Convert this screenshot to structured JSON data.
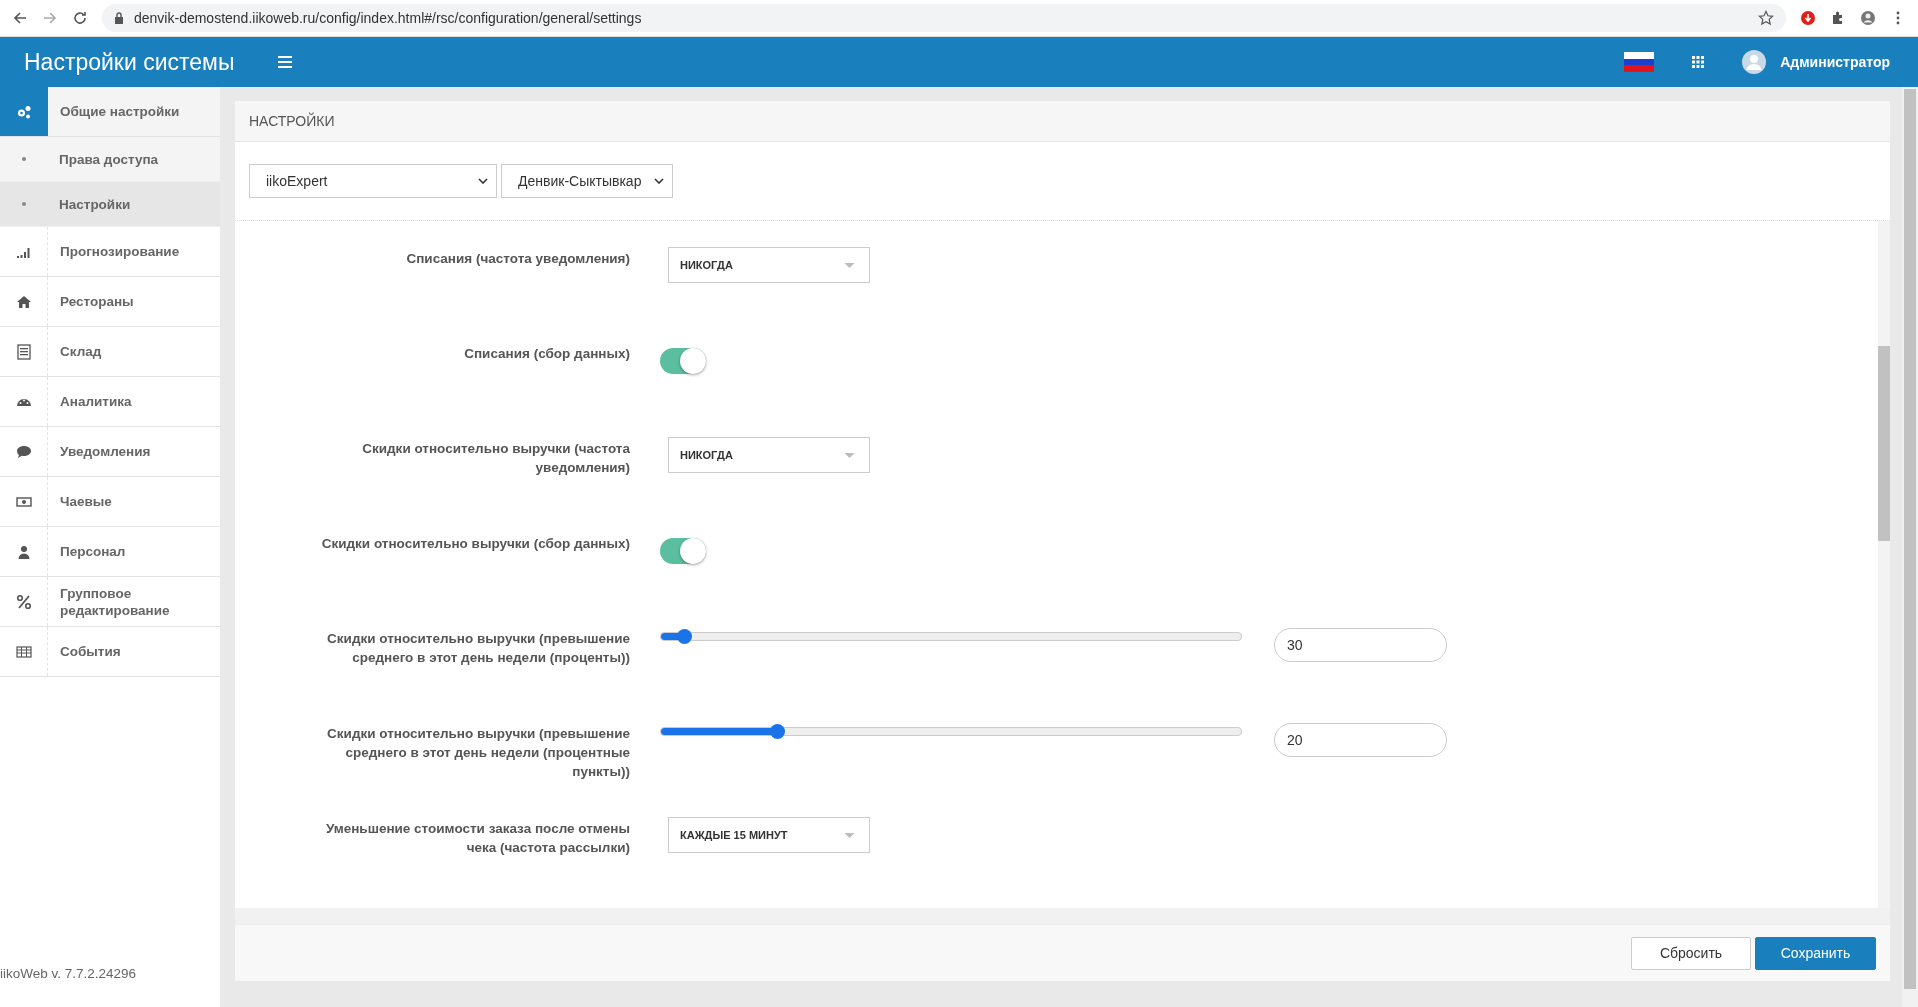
{
  "browser": {
    "url": "denvik-demostend.iikoweb.ru/config/index.html#/rsc/configuration/general/settings"
  },
  "header": {
    "title": "Настройки системы",
    "user": "Администратор"
  },
  "sidebar": {
    "items": [
      {
        "label": "Общие настройки",
        "selected": true,
        "children": [
          {
            "label": "Права доступа",
            "selected": false
          },
          {
            "label": "Настройки",
            "selected": true
          }
        ]
      },
      {
        "label": "Прогнозирование",
        "selected": false
      },
      {
        "label": "Рестораны",
        "selected": false
      },
      {
        "label": "Склад",
        "selected": false
      },
      {
        "label": "Аналитика",
        "selected": false
      },
      {
        "label": "Уведомления",
        "selected": false
      },
      {
        "label": "Чаевые",
        "selected": false
      },
      {
        "label": "Персонал",
        "selected": false
      },
      {
        "label": "Групповое редактирование",
        "selected": false
      },
      {
        "label": "События",
        "selected": false
      }
    ],
    "version": "iikoWeb v. 7.7.2.24296"
  },
  "panel": {
    "title": "НАСТРОЙКИ",
    "filters": [
      "iikoExpert",
      "Денвик-Сыктывкар"
    ],
    "rows": [
      {
        "kind": "select",
        "label": "Списания (частота уведомления)",
        "value": "НИКОГДА"
      },
      {
        "kind": "toggle",
        "label": "Списания (сбор данных)",
        "on": true
      },
      {
        "kind": "select",
        "label": "Скидки относительно выручки (частота уведомления)",
        "value": "НИКОГДА"
      },
      {
        "kind": "toggle",
        "label": "Скидки относительно выручки (сбор данных)",
        "on": true
      },
      {
        "kind": "slider",
        "label": "Скидки относительно выручки (превышение среднего в этот день недели (проценты))",
        "level": 0.04,
        "value": "30"
      },
      {
        "kind": "slider",
        "label": "Скидки относительно выручки (превышение среднего в этот день недели (процентные пункты))",
        "level": 0.2,
        "value": "20"
      },
      {
        "kind": "select",
        "label": "Уменьшение стоимости заказа после отмены чека (частота рассылки)",
        "value": "КАЖДЫЕ 15 МИНУТ"
      }
    ],
    "buttons": [
      {
        "label": "Сбросить",
        "kind": "secondary"
      },
      {
        "label": "Сохранить",
        "kind": "primary"
      }
    ]
  }
}
